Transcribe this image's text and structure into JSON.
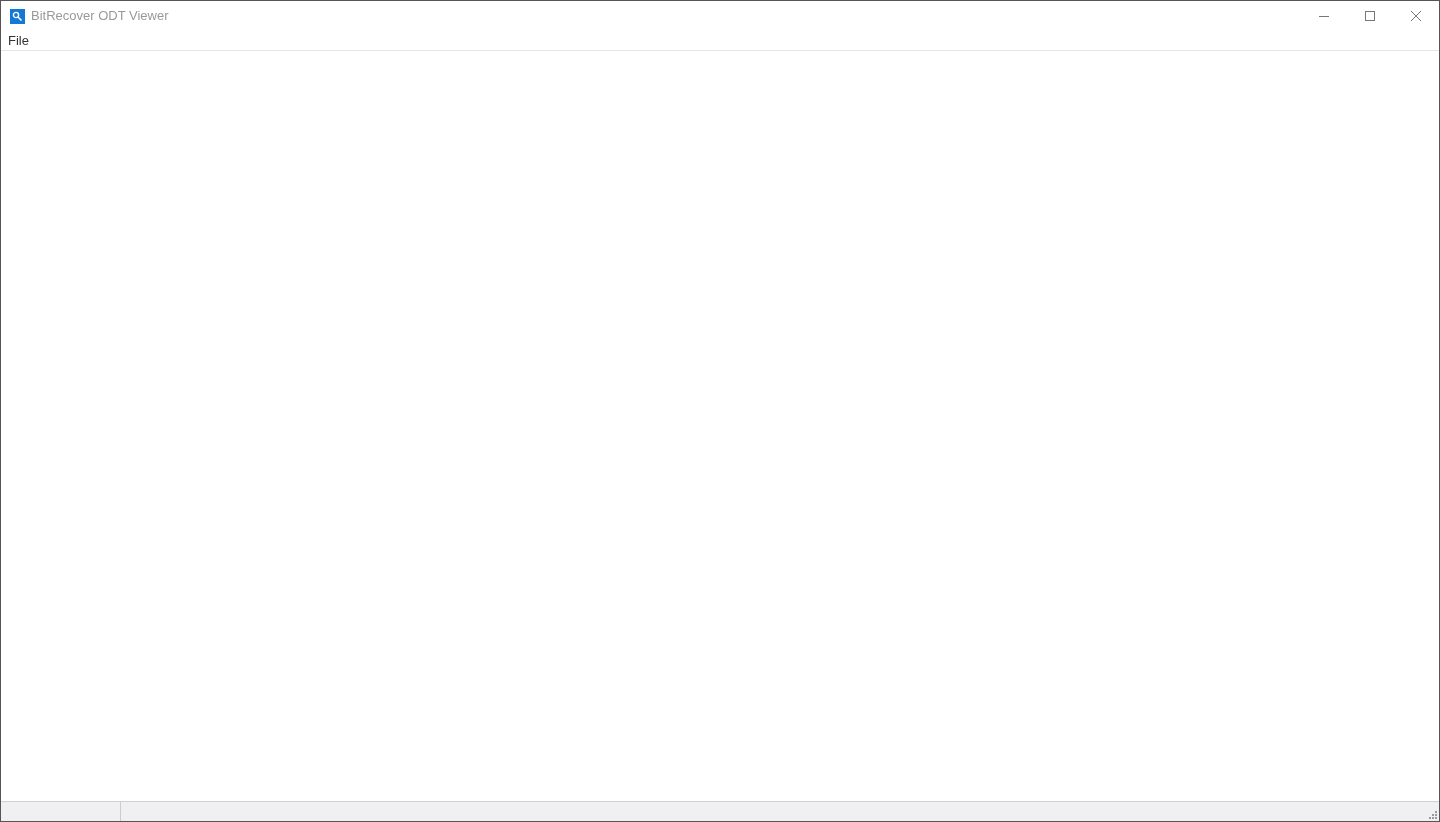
{
  "window": {
    "title": "BitRecover ODT Viewer"
  },
  "menu": [
    {
      "label": "File"
    }
  ]
}
